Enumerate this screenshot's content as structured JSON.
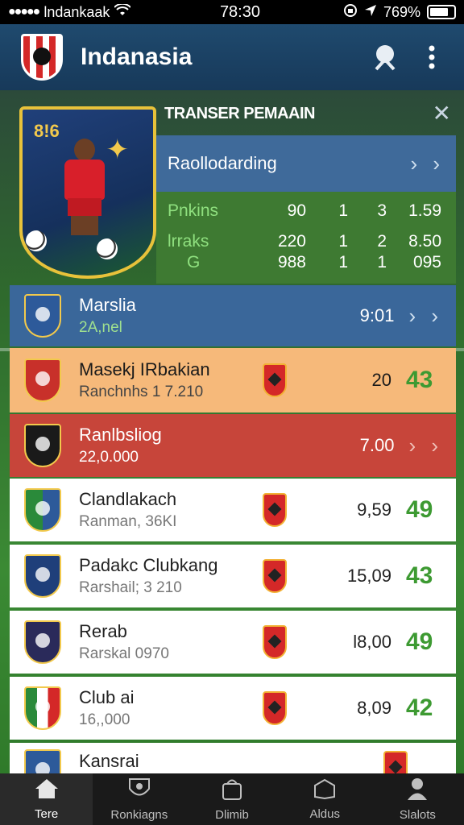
{
  "status_bar": {
    "carrier": "lndankaak",
    "time": "78:30",
    "battery": "769%",
    "battery_level": 0.8
  },
  "header": {
    "title": "Indanasia",
    "search_icon": "search-icon",
    "menu_icon": "more-vertical-icon"
  },
  "transfer_card": {
    "title": "TRANSER PEMAAIN",
    "shield_number": "8!6",
    "section_label": "Raollodarding",
    "stats": [
      {
        "name": "Pnkins",
        "v1": "90",
        "v2": "1",
        "v3": "3",
        "v4": "1.59"
      },
      {
        "name": "lrraks",
        "v1": "220",
        "v2": "1",
        "v3": "2",
        "v4": "8.50"
      },
      {
        "name": "G",
        "v1": "988",
        "v2": "1",
        "v3": "1",
        "v4": "095"
      }
    ]
  },
  "rows": [
    {
      "name": "Marslia",
      "sub": "2A,nel",
      "value": "9:01",
      "rating": "",
      "chevron": "› ›"
    },
    {
      "name": "Masekj IRbakian",
      "sub": "Ranchnhs 1 7.210",
      "value": "20",
      "rating": "43",
      "chevron": ""
    },
    {
      "name": "Ranlbsliog",
      "sub": "22,0.000",
      "value": "7.00",
      "rating": "",
      "chevron": "› ›"
    },
    {
      "name": "Clandlakach",
      "sub": "Ranman, 36KI",
      "value": "9,59",
      "rating": "49",
      "chevron": ""
    },
    {
      "name": "Padakc Clubkang",
      "sub": "Rarshail; 3 210",
      "value": "15,09",
      "rating": "43",
      "chevron": ""
    },
    {
      "name": "Rerab",
      "sub": "Rarskal 0970",
      "value": "l8,00",
      "rating": "49",
      "chevron": ""
    },
    {
      "name": "Club ai",
      "sub": "16,,000",
      "value": "8,09",
      "rating": "42",
      "chevron": ""
    },
    {
      "name": "Kansrai",
      "sub": "",
      "value": "",
      "rating": "",
      "chevron": ""
    }
  ],
  "nav": [
    {
      "label": "Tere",
      "icon": "home-icon"
    },
    {
      "label": "Ronkiagns",
      "icon": "crest-icon"
    },
    {
      "label": "Dlimib",
      "icon": "bag-icon"
    },
    {
      "label": "Aldus",
      "icon": "book-icon"
    },
    {
      "label": "Slalots",
      "icon": "user-icon"
    }
  ],
  "colors": {
    "header": "#1f4a6e",
    "rating_green": "#3d9a32",
    "row_blue": "#3a679a",
    "row_orange": "#f6b97a",
    "row_red": "#c7453a"
  }
}
